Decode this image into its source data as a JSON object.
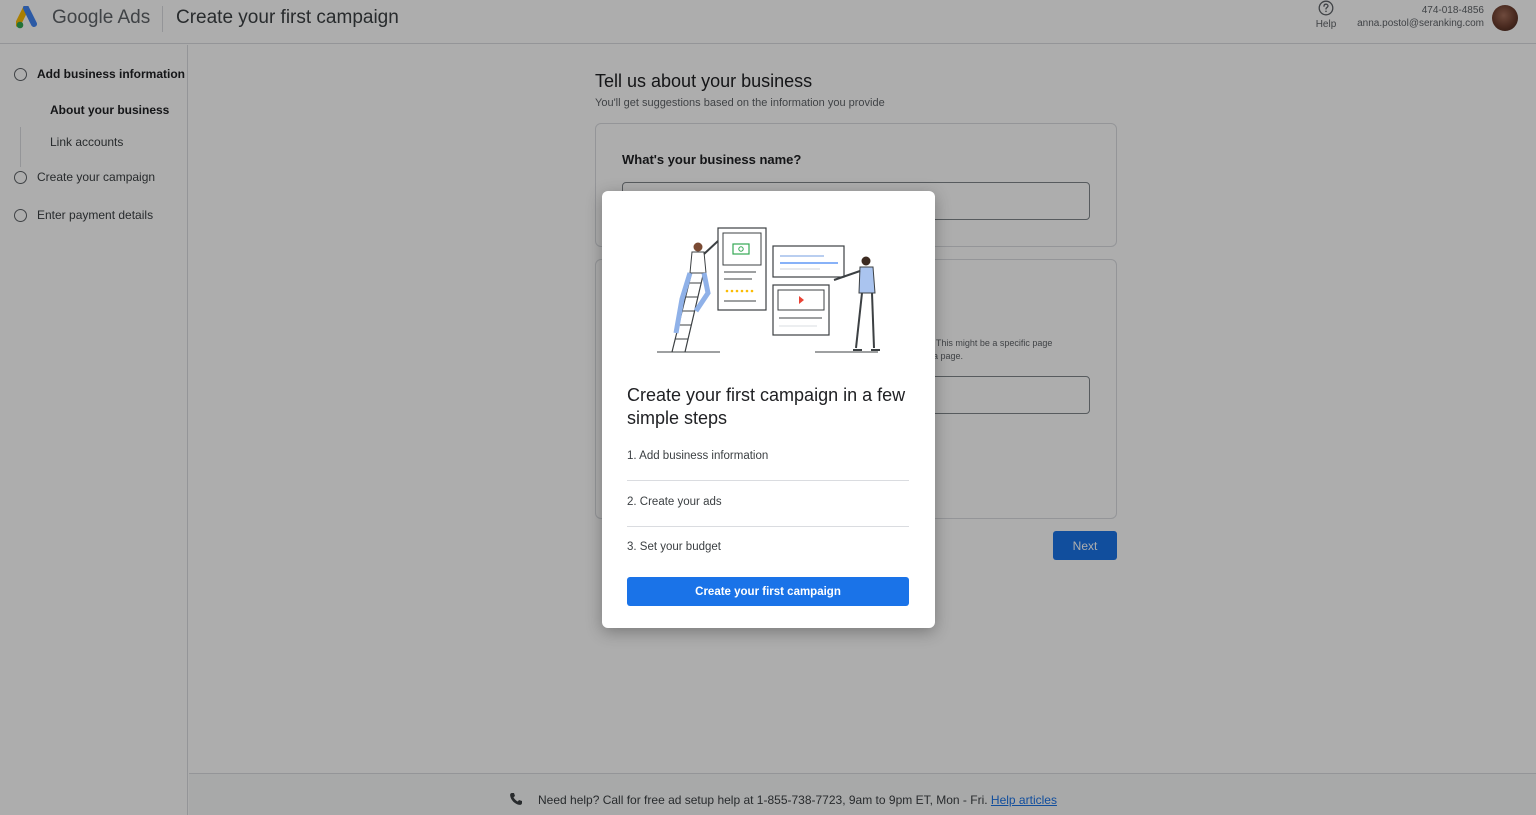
{
  "header": {
    "brand": "Google Ads",
    "title": "Create your first campaign",
    "help_label": "Help",
    "account_id": "474-018-4856",
    "account_email": "anna.postol@seranking.com"
  },
  "sidebar": {
    "steps": [
      {
        "label": "Add business information",
        "substeps": [
          "About your business",
          "Link accounts"
        ]
      },
      {
        "label": "Create your campaign"
      },
      {
        "label": "Enter payment details"
      }
    ]
  },
  "main": {
    "heading": "Tell us about your business",
    "subheading": "You'll get suggestions based on the information you provide",
    "business_name_question": "What's your business name?",
    "url_help": "L. This might be a specific page\ndia page.",
    "next_label": "Next"
  },
  "footer": {
    "text": "Need help? Call for free ad setup help at 1-855-738-7723, 9am to 9pm ET, Mon - Fri.",
    "link": "Help articles"
  },
  "dialog": {
    "title": "Create your first campaign in a few simple steps",
    "steps": [
      "1. Add business information",
      "2. Create your ads",
      "3. Set your budget"
    ],
    "button_label": "Create your first campaign"
  },
  "colors": {
    "accent": "#1a73e8",
    "google_yellow": "#fbbc04",
    "google_green": "#34a853",
    "google_red": "#ea4335"
  }
}
